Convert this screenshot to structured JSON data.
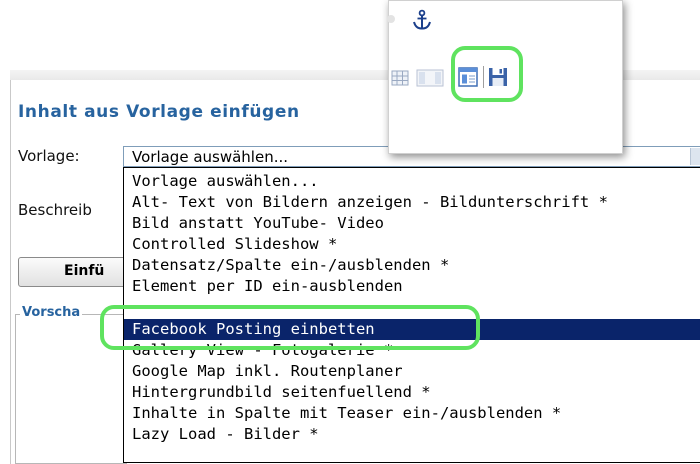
{
  "dialog": {
    "title": "Inhalt aus Vorlage einfügen",
    "vorlage_label": "Vorlage:",
    "beschreibung_label": "Beschreib",
    "insert_button": "Einfü",
    "preview_legend": "Vorscha"
  },
  "select": {
    "value": "Vorlage auswählen..."
  },
  "options": [
    {
      "label": "Vorlage auswählen...",
      "selected": false
    },
    {
      "label": "Alt- Text von Bildern anzeigen - Bildunterschrift *",
      "selected": false
    },
    {
      "label": "Bild anstatt YouTube- Video",
      "selected": false
    },
    {
      "label": "Controlled Slideshow *",
      "selected": false
    },
    {
      "label": "Datensatz/Spalte ein-/ausblenden *",
      "selected": false
    },
    {
      "label": "Element per ID ein-ausblenden",
      "selected": false
    },
    {
      "label": "Facebook Posting einbetten",
      "selected": true
    },
    {
      "label": "Gallery View - Fotogalerie *",
      "selected": false
    },
    {
      "label": "Google Map inkl. Routenplaner",
      "selected": false
    },
    {
      "label": "Hintergrundbild seitenfuellend *",
      "selected": false
    },
    {
      "label": "Inhalte in Spalte mit Teaser ein-/ausblenden *",
      "selected": false
    },
    {
      "label": "Lazy Load - Bilder *",
      "selected": false
    }
  ],
  "toolbar_popup": {
    "icons": [
      "anchor-icon",
      "table-icon",
      "columns-icon",
      "template-icon",
      "save-icon"
    ]
  },
  "colors": {
    "title_blue": "#27639f",
    "selection": "#0a246a",
    "highlight_ring": "#5fe35f"
  }
}
